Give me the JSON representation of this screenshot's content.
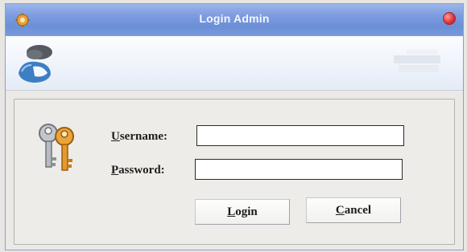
{
  "window": {
    "title": "Login Admin",
    "title_color": "#f4f6ff",
    "titlebar_color": "#7d9ddf",
    "close_color": "#e0353a"
  },
  "icons": {
    "app": "gear-icon",
    "banner": "users-icon",
    "form": "keys-icon",
    "close": "close-icon"
  },
  "form": {
    "username_label": {
      "first": "U",
      "rest": "sername:"
    },
    "password_label": {
      "first": "P",
      "rest": "assword:"
    },
    "username_value": "",
    "password_value": ""
  },
  "buttons": {
    "login": {
      "first": "L",
      "rest": "ogin"
    },
    "cancel": {
      "first": "C",
      "rest": "ancel"
    }
  }
}
